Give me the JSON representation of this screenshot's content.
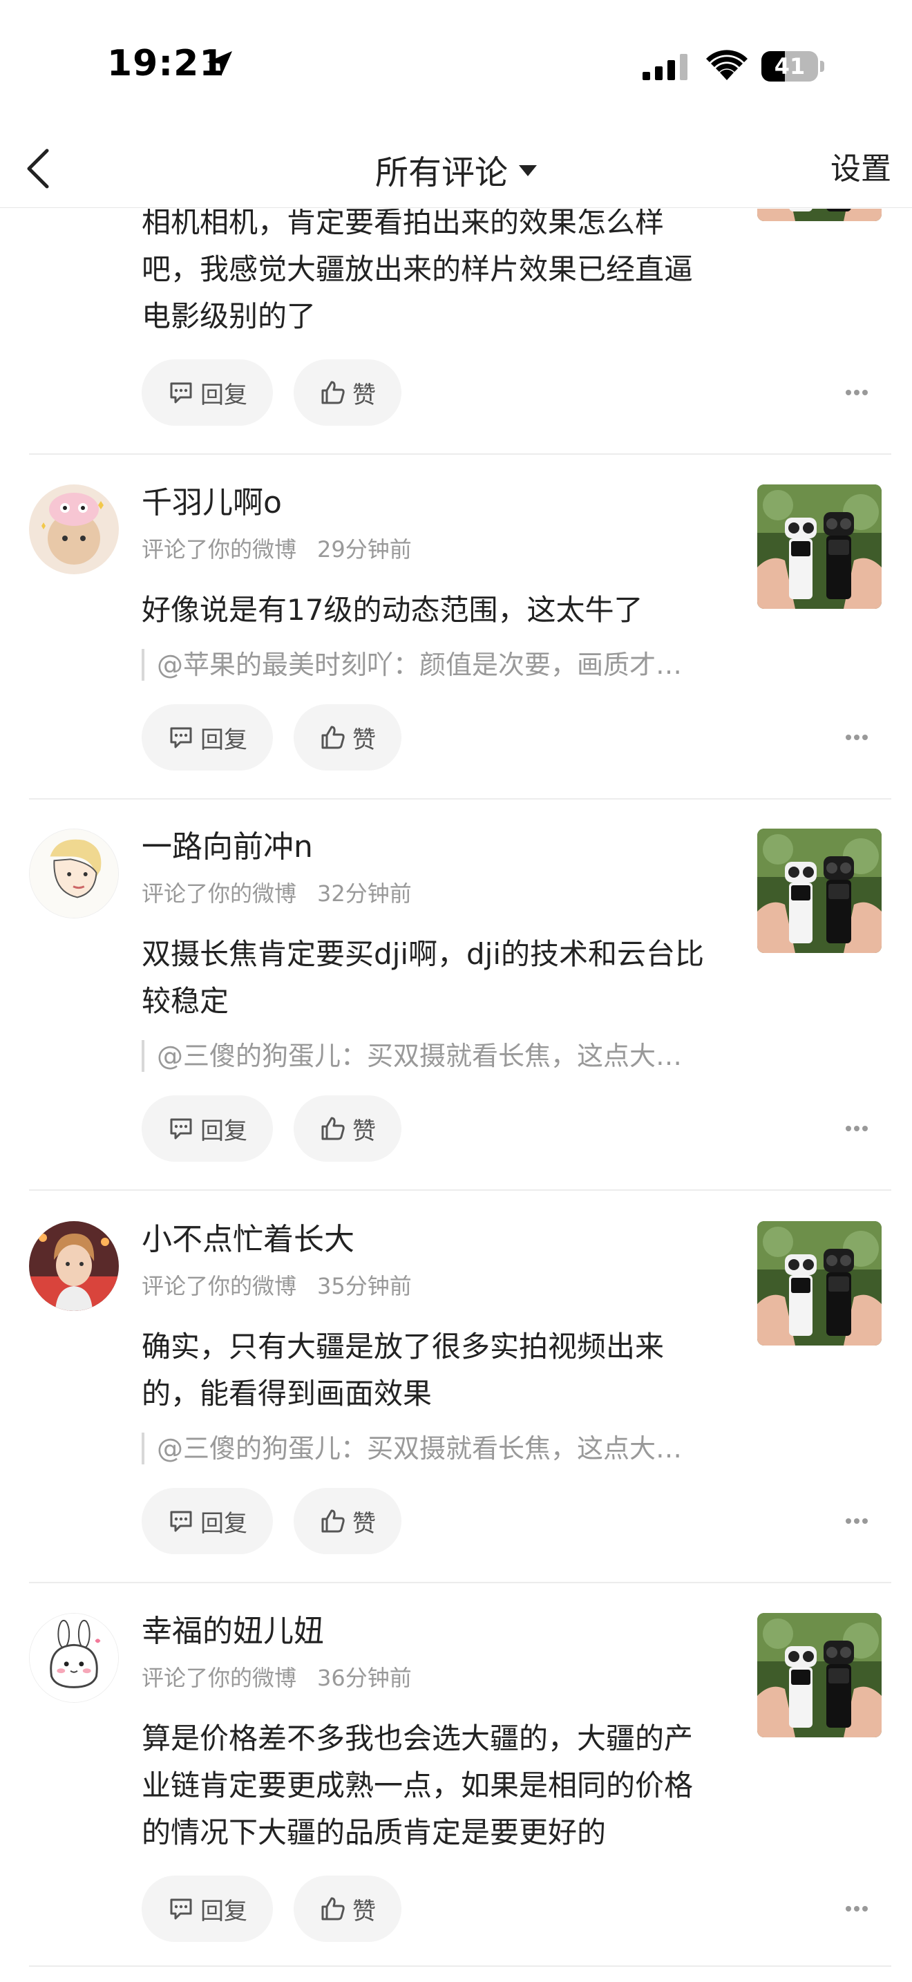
{
  "status_bar": {
    "time": "19:21",
    "battery_percent": 41,
    "battery_label": "41"
  },
  "nav": {
    "title": "所有评论",
    "settings_label": "设置"
  },
  "labels": {
    "reply": "回复",
    "like": "赞"
  },
  "colors": {
    "text_primary": "#222222",
    "text_secondary": "#999999",
    "pill_bg": "#f4f4f4",
    "divider": "#ececec"
  },
  "partial_comment": {
    "text": "相机相机，肯定要看拍出来的效果怎么样吧，我感觉大疆放出来的样片效果已经直逼电影级别的了"
  },
  "comments": [
    {
      "username": "千羽儿啊o",
      "action": "评论了你的微博",
      "time": "29分钟前",
      "text": "好像说是有17级的动态范围，这太牛了",
      "quote": "@苹果的最美时刻吖：颜值是次要，画质才…"
    },
    {
      "username": "一路向前冲n",
      "action": "评论了你的微博",
      "time": "32分钟前",
      "text": "双摄长焦肯定要买dji啊，dji的技术和云台比较稳定",
      "quote": "@三傻的狗蛋儿：买双摄就看长焦，这点大…"
    },
    {
      "username": "小不点忙着长大",
      "action": "评论了你的微博",
      "time": "35分钟前",
      "text": "确实，只有大疆是放了很多实拍视频出来的，能看得到画面效果",
      "quote": "@三傻的狗蛋儿：买双摄就看长焦，这点大…"
    },
    {
      "username": "幸福的妞儿妞",
      "action": "评论了你的微博",
      "time": "36分钟前",
      "text": "算是价格差不多我也会选大疆的，大疆的产业链肯定要更成熟一点，如果是相同的价格的情况下大疆的品质肯定是要更好的"
    }
  ]
}
